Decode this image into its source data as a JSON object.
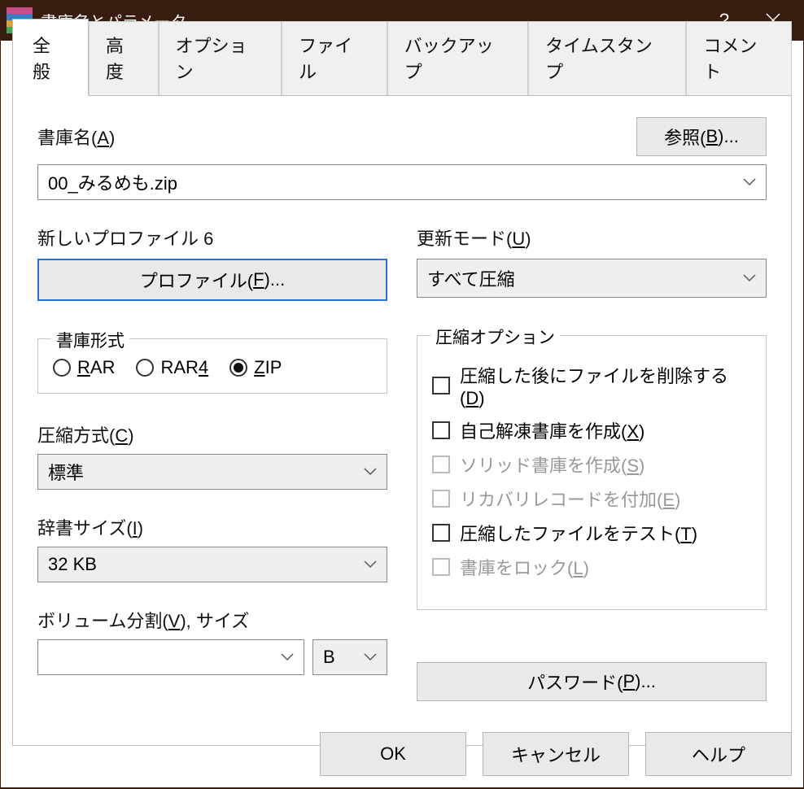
{
  "titlebar": {
    "title": "書庫名とパラメータ"
  },
  "tabs": {
    "general": "全般",
    "advanced": "高度",
    "options": "オプション",
    "files": "ファイル",
    "backup": "バックアップ",
    "time": "タイムスタンプ",
    "comment": "コメント"
  },
  "archive": {
    "label_pre": "書庫名(",
    "label_u": "A",
    "label_post": ")",
    "browse_pre": "参照(",
    "browse_u": "B",
    "browse_post": ")...",
    "value": "00_みるめも.zip"
  },
  "profile": {
    "label": "新しいプロファイル 6",
    "button_pre": "プロファイル(",
    "button_u": "F",
    "button_post": ")..."
  },
  "update": {
    "label_pre": "更新モード(",
    "label_u": "U",
    "label_post": ")",
    "value": "すべて圧縮"
  },
  "format": {
    "legend": "書庫形式",
    "rar_u": "R",
    "rar_post": "AR",
    "rar4_pre": "RAR",
    "rar4_u": "4",
    "zip_u": "Z",
    "zip_post": "IP"
  },
  "method": {
    "label_pre": "圧縮方式(",
    "label_u": "C",
    "label_post": ")",
    "value": "標準"
  },
  "dict": {
    "label_pre": "辞書サイズ(",
    "label_u": "I",
    "label_post": ")",
    "value": "32 KB"
  },
  "volume": {
    "label_pre": "ボリューム分割(",
    "label_u": "V",
    "label_post": "), サイズ",
    "unit": "B"
  },
  "options": {
    "legend": "圧縮オプション",
    "del_pre": "圧縮した後にファイルを削除する(",
    "del_u": "D",
    "del_post": ")",
    "sfx_pre": "自己解凍書庫を作成(",
    "sfx_u": "X",
    "sfx_post": ")",
    "solid_pre": "ソリッド書庫を作成(",
    "solid_u": "S",
    "solid_post": ")",
    "rec_pre": "リカバリレコードを付加(",
    "rec_u": "E",
    "rec_post": ")",
    "test_pre": "圧縮したファイルをテスト(",
    "test_u": "T",
    "test_post": ")",
    "lock_pre": "書庫をロック(",
    "lock_u": "L",
    "lock_post": ")"
  },
  "password": {
    "label_pre": "パスワード(",
    "label_u": "P",
    "label_post": ")..."
  },
  "footer": {
    "ok": "OK",
    "cancel": "キャンセル",
    "help": "ヘルプ"
  }
}
